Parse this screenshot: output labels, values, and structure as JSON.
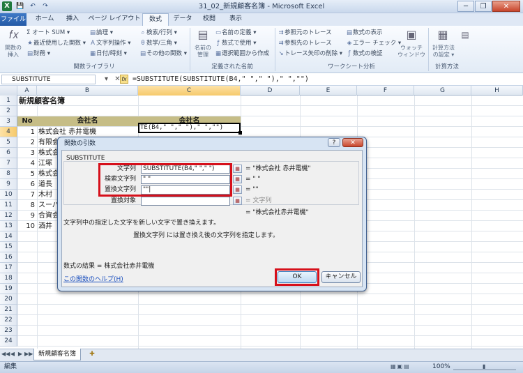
{
  "window": {
    "title": "31_02_新規顧客名簿 - Microsoft Excel",
    "minimize": "─",
    "restore": "❐",
    "close": "✕",
    "app_icon": "X",
    "qat": [
      "💾",
      "↶",
      "↷"
    ]
  },
  "ribbon": {
    "tabs": [
      "ファイル",
      "ホーム",
      "挿入",
      "ページ レイアウト",
      "数式",
      "データ",
      "校閲",
      "表示"
    ],
    "active_tab": "数式",
    "insert_function": "関数の\n挿入",
    "library": {
      "col1": [
        "Σ オート SUM ▾",
        "最近使用した関数 ▾",
        "財務 ▾"
      ],
      "col2": [
        "論理 ▾",
        "文字列操作 ▾",
        "日付/時刻 ▾"
      ],
      "col3": [
        "検索/行列 ▾",
        "数学/三角 ▾",
        "その他の関数 ▾"
      ],
      "group_label": "関数ライブラリ"
    },
    "names": {
      "manager": "名前の\n管理",
      "items": [
        "名前の定義 ▾",
        "数式で使用 ▾",
        "選択範囲から作成"
      ],
      "group_label": "定義された名前"
    },
    "audit": {
      "col1": [
        "参照元のトレース",
        "参照先のトレース",
        "トレース矢印の削除 ▾"
      ],
      "col2": [
        "数式の表示",
        "エラー チェック ▾",
        "数式の検証"
      ],
      "watch": "ウォッチ\nウィンドウ",
      "group_label": "ワークシート分析"
    },
    "calc": {
      "options": "計算方法\nの設定 ▾",
      "group_label": "計算方法"
    }
  },
  "formula_bar": {
    "name_box": "SUBSTITUTE",
    "formula": "=SUBSTITUTE(SUBSTITUTE(B4,\" \",\" \"),\" \",\"\")",
    "icons": "▾ ✕ ✓",
    "fx": "fx"
  },
  "columns": [
    "A",
    "B",
    "C",
    "D",
    "E",
    "F",
    "G",
    "H"
  ],
  "rows": [
    "1",
    "2",
    "3",
    "4",
    "5",
    "6",
    "7",
    "8",
    "9",
    "10",
    "11",
    "12",
    "13",
    "14",
    "15",
    "16",
    "17",
    "18",
    "19",
    "20",
    "21",
    "22",
    "23",
    "24"
  ],
  "sheet": {
    "title": "新規顧客名簿",
    "header_no": "No",
    "header_b": "会社名",
    "header_c": "会社名",
    "active_cell_text": "TE(B4,\" \",\" \"),\" \",\"\")",
    "numbers": [
      "1",
      "2",
      "3",
      "4",
      "5",
      "6",
      "7",
      "8",
      "9",
      "10"
    ],
    "companies": [
      "株式会社 赤井電機",
      "有限会社 井上商店",
      "株式会",
      "江塚",
      "株式会",
      "道長",
      "木村",
      "スーパ",
      "合資会",
      "酒井"
    ]
  },
  "dialog": {
    "title": "関数の引数",
    "help_btn": "?",
    "close_btn": "✕",
    "function_name": "SUBSTITUTE",
    "args": [
      {
        "label": "文字列",
        "value": "SUBSTITUTE(B4,\" \",\" \")",
        "result": "= \"株式会社 赤井電機\""
      },
      {
        "label": "検索文字列",
        "value": "\" \"",
        "result": "= \" \""
      },
      {
        "label": "置換文字列",
        "value": "\"\"|",
        "result": "= \"\""
      },
      {
        "label": "置換対象",
        "value": "",
        "result": "= 文字列"
      }
    ],
    "ref_icon": "▦",
    "result_line": "= \"株式会社赤井電機\"",
    "description": "文字列中の指定した文字を新しい文字で置き換えます。",
    "arg_description": "置換文字列  には置き換え後の文字列を指定します。",
    "formula_result": "数式の結果 =   株式会社赤井電機",
    "help_link": "この関数のヘルプ(H)",
    "ok": "OK",
    "cancel": "キャンセル"
  },
  "sheet_tabs": {
    "active": "新規顧客名簿",
    "nav": [
      "◀◀",
      "◀",
      "▶",
      "▶▶"
    ]
  },
  "status": {
    "mode": "編集",
    "zoom": "100%"
  }
}
